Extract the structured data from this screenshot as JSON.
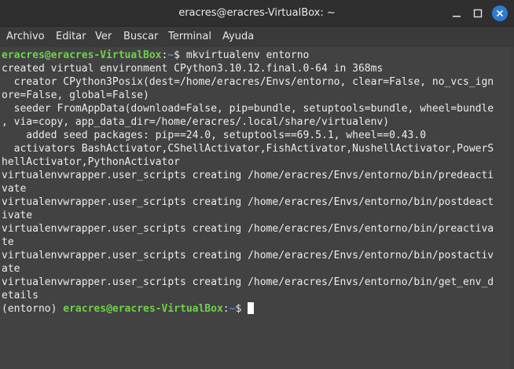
{
  "window": {
    "title": "eracres@eracres-VirtualBox: ~"
  },
  "menu": {
    "items": [
      {
        "label": "Archivo"
      },
      {
        "label": "Editar"
      },
      {
        "label": "Ver"
      },
      {
        "label": "Buscar"
      },
      {
        "label": "Terminal"
      },
      {
        "label": "Ayuda"
      }
    ]
  },
  "terminal": {
    "prompt1": {
      "userhost": "eracres@eracres-VirtualBox",
      "sep": ":",
      "path": "~",
      "dollar": "$ ",
      "command": "mkvirtualenv entorno"
    },
    "lines": [
      "created virtual environment CPython3.10.12.final.0-64 in 368ms",
      "  creator CPython3Posix(dest=/home/eracres/Envs/entorno, clear=False, no_vcs_ign",
      "ore=False, global=False)",
      "  seeder FromAppData(download=False, pip=bundle, setuptools=bundle, wheel=bundle",
      ", via=copy, app_data_dir=/home/eracres/.local/share/virtualenv)",
      "    added seed packages: pip==24.0, setuptools==69.5.1, wheel==0.43.0",
      "  activators BashActivator,CShellActivator,FishActivator,NushellActivator,PowerS",
      "hellActivator,PythonActivator",
      "virtualenvwrapper.user_scripts creating /home/eracres/Envs/entorno/bin/predeacti",
      "vate",
      "virtualenvwrapper.user_scripts creating /home/eracres/Envs/entorno/bin/postdeact",
      "ivate",
      "virtualenvwrapper.user_scripts creating /home/eracres/Envs/entorno/bin/preactiva",
      "te",
      "virtualenvwrapper.user_scripts creating /home/eracres/Envs/entorno/bin/postactiv",
      "ate",
      "virtualenvwrapper.user_scripts creating /home/eracres/Envs/entorno/bin/get_env_d",
      "etails"
    ],
    "prompt2": {
      "env": "(entorno) ",
      "userhost": "eracres@eracres-VirtualBox",
      "sep": ":",
      "path": "~",
      "dollar": "$ "
    }
  }
}
